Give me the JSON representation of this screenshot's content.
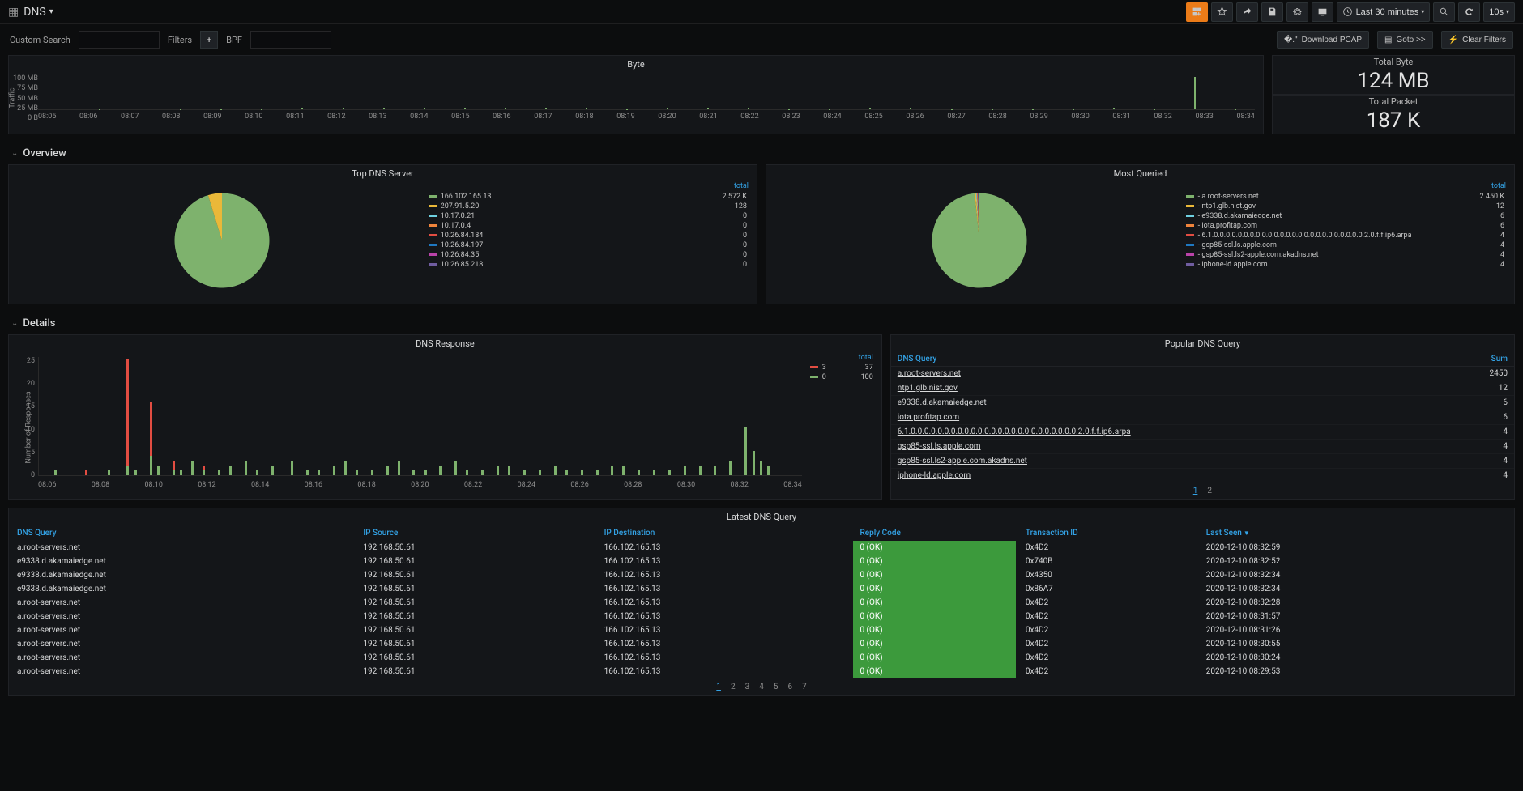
{
  "header": {
    "title": "DNS",
    "time_range": "Last 30 minutes",
    "refresh_interval": "10s"
  },
  "filterbar": {
    "custom_search_label": "Custom Search",
    "filters_label": "Filters",
    "bpf_label": "BPF",
    "download_pcap": "Download PCAP",
    "goto": "Goto >>",
    "clear_filters": "Clear Filters"
  },
  "byte_panel": {
    "title": "Byte",
    "ylabel": "Traffic",
    "yticks": [
      "100 MB",
      "75 MB",
      "50 MB",
      "25 MB",
      "0 B"
    ],
    "xticks": [
      "08:05",
      "08:06",
      "08:07",
      "08:08",
      "08:09",
      "08:10",
      "08:11",
      "08:12",
      "08:13",
      "08:14",
      "08:15",
      "08:16",
      "08:17",
      "08:18",
      "08:19",
      "08:20",
      "08:21",
      "08:22",
      "08:23",
      "08:24",
      "08:25",
      "08:26",
      "08:27",
      "08:28",
      "08:29",
      "08:30",
      "08:31",
      "08:32",
      "08:33",
      "08:34"
    ]
  },
  "totals": {
    "byte_label": "Total Byte",
    "byte_value": "124 MB",
    "packet_label": "Total Packet",
    "packet_value": "187 K"
  },
  "sections": {
    "overview": "Overview",
    "details": "Details"
  },
  "top_dns_server": {
    "title": "Top DNS Server",
    "legend_header": "total",
    "items": [
      {
        "color": "#7eb26d",
        "label": "166.102.165.13",
        "value": "2.572 K"
      },
      {
        "color": "#eab839",
        "label": "207.91.5.20",
        "value": "128"
      },
      {
        "color": "#6ed0e0",
        "label": "10.17.0.21",
        "value": "0"
      },
      {
        "color": "#ef843c",
        "label": "10.17.0.4",
        "value": "0"
      },
      {
        "color": "#e24d42",
        "label": "10.26.84.184",
        "value": "0"
      },
      {
        "color": "#1f78c1",
        "label": "10.26.84.197",
        "value": "0"
      },
      {
        "color": "#ba43a9",
        "label": "10.26.84.35",
        "value": "0"
      },
      {
        "color": "#705da0",
        "label": "10.26.85.218",
        "value": "0"
      }
    ]
  },
  "most_queried": {
    "title": "Most Queried",
    "legend_header": "total",
    "items": [
      {
        "color": "#7eb26d",
        "label": "- a.root-servers.net",
        "value": "2.450 K"
      },
      {
        "color": "#eab839",
        "label": "- ntp1.glb.nist.gov",
        "value": "12"
      },
      {
        "color": "#6ed0e0",
        "label": "- e9338.d.akamaiedge.net",
        "value": "6"
      },
      {
        "color": "#ef843c",
        "label": "- iota.profitap.com",
        "value": "6"
      },
      {
        "color": "#e24d42",
        "label": "- 6.1.0.0.0.0.0.0.0.0.0.0.0.0.0.0.0.0.0.0.0.0.0.0.0.0.0.2.0.f.f.ip6.arpa",
        "value": "4"
      },
      {
        "color": "#1f78c1",
        "label": "- gsp85-ssl.ls.apple.com",
        "value": "4"
      },
      {
        "color": "#ba43a9",
        "label": "- gsp85-ssl.ls2-apple.com.akadns.net",
        "value": "4"
      },
      {
        "color": "#705da0",
        "label": "- iphone-ld.apple.com",
        "value": "4"
      }
    ]
  },
  "dns_response": {
    "title": "DNS Response",
    "ylabel": "Number of Responses",
    "yticks": [
      "25",
      "20",
      "15",
      "10",
      "5",
      "0"
    ],
    "xticks": [
      "08:06",
      "08:08",
      "08:10",
      "08:12",
      "08:14",
      "08:16",
      "08:18",
      "08:20",
      "08:22",
      "08:24",
      "08:26",
      "08:28",
      "08:30",
      "08:32",
      "08:34"
    ],
    "legend_header": "total",
    "legend": [
      {
        "color": "#e24d42",
        "label": "3",
        "value": "37"
      },
      {
        "color": "#7eb26d",
        "label": "0",
        "value": "100"
      }
    ]
  },
  "popular_dns": {
    "title": "Popular DNS Query",
    "col_query": "DNS Query",
    "col_sum": "Sum",
    "rows": [
      {
        "q": "a.root-servers.net",
        "sum": "2450"
      },
      {
        "q": "ntp1.glb.nist.gov",
        "sum": "12"
      },
      {
        "q": "e9338.d.akamaiedge.net",
        "sum": "6"
      },
      {
        "q": "iota.profitap.com",
        "sum": "6"
      },
      {
        "q": "6.1.0.0.0.0.0.0.0.0.0.0.0.0.0.0.0.0.0.0.0.0.0.0.0.0.0.2.0.f.f.ip6.arpa",
        "sum": "4"
      },
      {
        "q": "gsp85-ssl.ls.apple.com",
        "sum": "4"
      },
      {
        "q": "gsp85-ssl.ls2-apple.com.akadns.net",
        "sum": "4"
      },
      {
        "q": "iphone-ld.apple.com",
        "sum": "4"
      }
    ],
    "pages": [
      "1",
      "2"
    ],
    "current_page": "1"
  },
  "latest_dns": {
    "title": "Latest DNS Query",
    "cols": {
      "query": "DNS Query",
      "ipsrc": "IP Source",
      "ipdst": "IP Destination",
      "reply": "Reply Code",
      "txn": "Transaction ID",
      "last": "Last Seen"
    },
    "rows": [
      {
        "q": "a.root-servers.net",
        "src": "192.168.50.61",
        "dst": "166.102.165.13",
        "reply": "0 (OK)",
        "txn": "0x4D2",
        "last": "2020-12-10 08:32:59"
      },
      {
        "q": "e9338.d.akamaiedge.net",
        "src": "192.168.50.61",
        "dst": "166.102.165.13",
        "reply": "0 (OK)",
        "txn": "0x740B",
        "last": "2020-12-10 08:32:52"
      },
      {
        "q": "e9338.d.akamaiedge.net",
        "src": "192.168.50.61",
        "dst": "166.102.165.13",
        "reply": "0 (OK)",
        "txn": "0x4350",
        "last": "2020-12-10 08:32:34"
      },
      {
        "q": "e9338.d.akamaiedge.net",
        "src": "192.168.50.61",
        "dst": "166.102.165.13",
        "reply": "0 (OK)",
        "txn": "0x86A7",
        "last": "2020-12-10 08:32:34"
      },
      {
        "q": "a.root-servers.net",
        "src": "192.168.50.61",
        "dst": "166.102.165.13",
        "reply": "0 (OK)",
        "txn": "0x4D2",
        "last": "2020-12-10 08:32:28"
      },
      {
        "q": "a.root-servers.net",
        "src": "192.168.50.61",
        "dst": "166.102.165.13",
        "reply": "0 (OK)",
        "txn": "0x4D2",
        "last": "2020-12-10 08:31:57"
      },
      {
        "q": "a.root-servers.net",
        "src": "192.168.50.61",
        "dst": "166.102.165.13",
        "reply": "0 (OK)",
        "txn": "0x4D2",
        "last": "2020-12-10 08:31:26"
      },
      {
        "q": "a.root-servers.net",
        "src": "192.168.50.61",
        "dst": "166.102.165.13",
        "reply": "0 (OK)",
        "txn": "0x4D2",
        "last": "2020-12-10 08:30:55"
      },
      {
        "q": "a.root-servers.net",
        "src": "192.168.50.61",
        "dst": "166.102.165.13",
        "reply": "0 (OK)",
        "txn": "0x4D2",
        "last": "2020-12-10 08:30:24"
      },
      {
        "q": "a.root-servers.net",
        "src": "192.168.50.61",
        "dst": "166.102.165.13",
        "reply": "0 (OK)",
        "txn": "0x4D2",
        "last": "2020-12-10 08:29:53"
      }
    ],
    "pages": [
      "1",
      "2",
      "3",
      "4",
      "5",
      "6",
      "7"
    ],
    "current_page": "1"
  },
  "chart_data": [
    {
      "type": "bar",
      "name": "Byte",
      "ylabel": "Traffic",
      "ylim": [
        0,
        100
      ],
      "yunit": "MB",
      "x": [
        "08:05",
        "08:06",
        "08:07",
        "08:08",
        "08:09",
        "08:10",
        "08:11",
        "08:12",
        "08:13",
        "08:14",
        "08:15",
        "08:16",
        "08:17",
        "08:18",
        "08:19",
        "08:20",
        "08:21",
        "08:22",
        "08:23",
        "08:24",
        "08:25",
        "08:26",
        "08:27",
        "08:28",
        "08:29",
        "08:30",
        "08:31",
        "08:32",
        "08:33",
        "08:34"
      ],
      "values": [
        0,
        1,
        0,
        1,
        1,
        1,
        2,
        5,
        2,
        2,
        2,
        2,
        2,
        2,
        1,
        2,
        2,
        2,
        1,
        1,
        2,
        2,
        1,
        1,
        1,
        1,
        2,
        1,
        90,
        1
      ]
    },
    {
      "type": "pie",
      "name": "Top DNS Server",
      "series": [
        {
          "label": "166.102.165.13",
          "value": 2572,
          "color": "#7eb26d"
        },
        {
          "label": "207.91.5.20",
          "value": 128,
          "color": "#eab839"
        },
        {
          "label": "10.17.0.21",
          "value": 0,
          "color": "#6ed0e0"
        },
        {
          "label": "10.17.0.4",
          "value": 0,
          "color": "#ef843c"
        },
        {
          "label": "10.26.84.184",
          "value": 0,
          "color": "#e24d42"
        },
        {
          "label": "10.26.84.197",
          "value": 0,
          "color": "#1f78c1"
        },
        {
          "label": "10.26.84.35",
          "value": 0,
          "color": "#ba43a9"
        },
        {
          "label": "10.26.85.218",
          "value": 0,
          "color": "#705da0"
        }
      ]
    },
    {
      "type": "pie",
      "name": "Most Queried",
      "series": [
        {
          "label": "a.root-servers.net",
          "value": 2450,
          "color": "#7eb26d"
        },
        {
          "label": "ntp1.glb.nist.gov",
          "value": 12,
          "color": "#eab839"
        },
        {
          "label": "e9338.d.akamaiedge.net",
          "value": 6,
          "color": "#6ed0e0"
        },
        {
          "label": "iota.profitap.com",
          "value": 6,
          "color": "#ef843c"
        },
        {
          "label": "6.1...ip6.arpa",
          "value": 4,
          "color": "#e24d42"
        },
        {
          "label": "gsp85-ssl.ls.apple.com",
          "value": 4,
          "color": "#1f78c1"
        },
        {
          "label": "gsp85-ssl.ls2-apple.com.akadns.net",
          "value": 4,
          "color": "#ba43a9"
        },
        {
          "label": "iphone-ld.apple.com",
          "value": 4,
          "color": "#705da0"
        }
      ]
    },
    {
      "type": "bar",
      "name": "DNS Response",
      "ylabel": "Number of Responses",
      "ylim": [
        0,
        25
      ],
      "x_range": [
        "08:06",
        "08:34"
      ],
      "series": [
        {
          "name": "0",
          "color": "#7eb26d",
          "total": 100
        },
        {
          "name": "3",
          "color": "#e24d42",
          "total": 37
        }
      ],
      "stacked_bars": [
        {
          "x": 0.02,
          "ok": 1,
          "err": 0
        },
        {
          "x": 0.06,
          "ok": 0,
          "err": 1
        },
        {
          "x": 0.09,
          "ok": 1,
          "err": 0
        },
        {
          "x": 0.115,
          "ok": 2,
          "err": 22
        },
        {
          "x": 0.125,
          "ok": 1,
          "err": 0
        },
        {
          "x": 0.145,
          "ok": 4,
          "err": 11
        },
        {
          "x": 0.155,
          "ok": 2,
          "err": 0
        },
        {
          "x": 0.175,
          "ok": 1,
          "err": 2
        },
        {
          "x": 0.185,
          "ok": 1,
          "err": 0
        },
        {
          "x": 0.2,
          "ok": 3,
          "err": 0
        },
        {
          "x": 0.215,
          "ok": 1,
          "err": 1
        },
        {
          "x": 0.235,
          "ok": 1,
          "err": 0
        },
        {
          "x": 0.25,
          "ok": 2,
          "err": 0
        },
        {
          "x": 0.27,
          "ok": 3,
          "err": 0
        },
        {
          "x": 0.285,
          "ok": 1,
          "err": 0
        },
        {
          "x": 0.305,
          "ok": 2,
          "err": 0
        },
        {
          "x": 0.33,
          "ok": 3,
          "err": 0
        },
        {
          "x": 0.35,
          "ok": 1,
          "err": 0
        },
        {
          "x": 0.365,
          "ok": 1,
          "err": 0
        },
        {
          "x": 0.385,
          "ok": 2,
          "err": 0
        },
        {
          "x": 0.4,
          "ok": 3,
          "err": 0
        },
        {
          "x": 0.415,
          "ok": 1,
          "err": 0
        },
        {
          "x": 0.435,
          "ok": 1,
          "err": 0
        },
        {
          "x": 0.455,
          "ok": 2,
          "err": 0
        },
        {
          "x": 0.47,
          "ok": 3,
          "err": 0
        },
        {
          "x": 0.49,
          "ok": 1,
          "err": 0
        },
        {
          "x": 0.505,
          "ok": 1,
          "err": 0
        },
        {
          "x": 0.525,
          "ok": 2,
          "err": 0
        },
        {
          "x": 0.545,
          "ok": 3,
          "err": 0
        },
        {
          "x": 0.56,
          "ok": 1,
          "err": 0
        },
        {
          "x": 0.58,
          "ok": 1,
          "err": 0
        },
        {
          "x": 0.6,
          "ok": 2,
          "err": 0
        },
        {
          "x": 0.615,
          "ok": 2,
          "err": 0
        },
        {
          "x": 0.635,
          "ok": 1,
          "err": 0
        },
        {
          "x": 0.655,
          "ok": 1,
          "err": 0
        },
        {
          "x": 0.675,
          "ok": 2,
          "err": 0
        },
        {
          "x": 0.69,
          "ok": 1,
          "err": 0
        },
        {
          "x": 0.71,
          "ok": 1,
          "err": 0
        },
        {
          "x": 0.73,
          "ok": 1,
          "err": 0
        },
        {
          "x": 0.75,
          "ok": 2,
          "err": 0
        },
        {
          "x": 0.765,
          "ok": 2,
          "err": 0
        },
        {
          "x": 0.785,
          "ok": 1,
          "err": 0
        },
        {
          "x": 0.805,
          "ok": 1,
          "err": 0
        },
        {
          "x": 0.825,
          "ok": 1,
          "err": 0
        },
        {
          "x": 0.845,
          "ok": 2,
          "err": 0
        },
        {
          "x": 0.865,
          "ok": 2,
          "err": 0
        },
        {
          "x": 0.885,
          "ok": 2,
          "err": 0
        },
        {
          "x": 0.905,
          "ok": 3,
          "err": 0
        },
        {
          "x": 0.925,
          "ok": 10,
          "err": 0
        },
        {
          "x": 0.935,
          "ok": 5,
          "err": 0
        },
        {
          "x": 0.945,
          "ok": 3,
          "err": 0
        },
        {
          "x": 0.955,
          "ok": 2,
          "err": 0
        }
      ]
    }
  ]
}
